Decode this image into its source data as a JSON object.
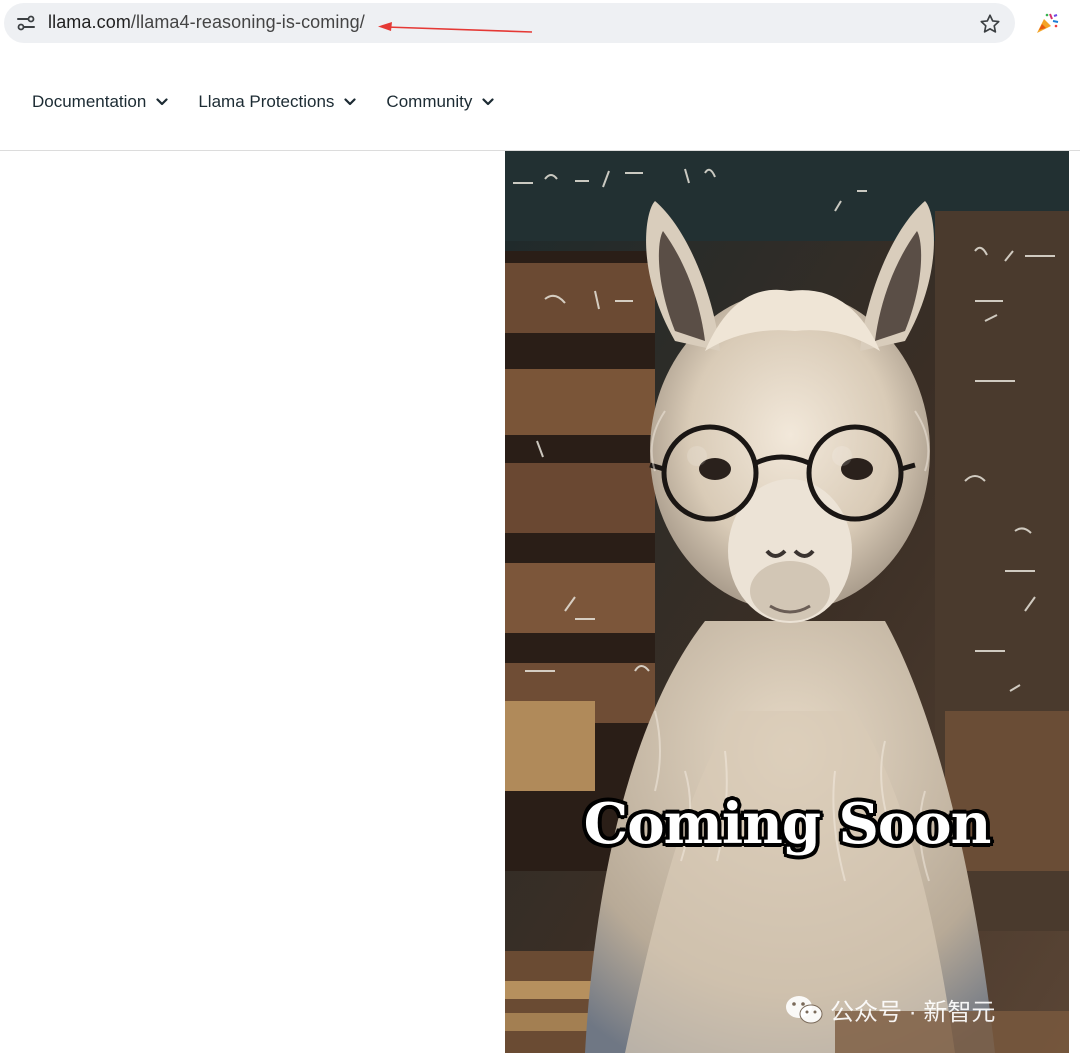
{
  "browser": {
    "url_domain": "llama.com",
    "url_path": "/llama4-reasoning-is-coming/",
    "icons": [
      "site-info-icon",
      "star-icon",
      "extension-icon"
    ]
  },
  "nav": {
    "items": [
      {
        "label": "Documentation"
      },
      {
        "label": "Llama Protections"
      },
      {
        "label": "Community"
      }
    ]
  },
  "hero": {
    "overlay_text": "Coming Soon"
  },
  "watermark": {
    "text": "公众号 · 新智元",
    "icon": "wechat-icon"
  },
  "colors": {
    "annotation_arrow": "#e53935",
    "nav_text": "#1c2b33",
    "omnibox_bg": "#eef0f3"
  }
}
